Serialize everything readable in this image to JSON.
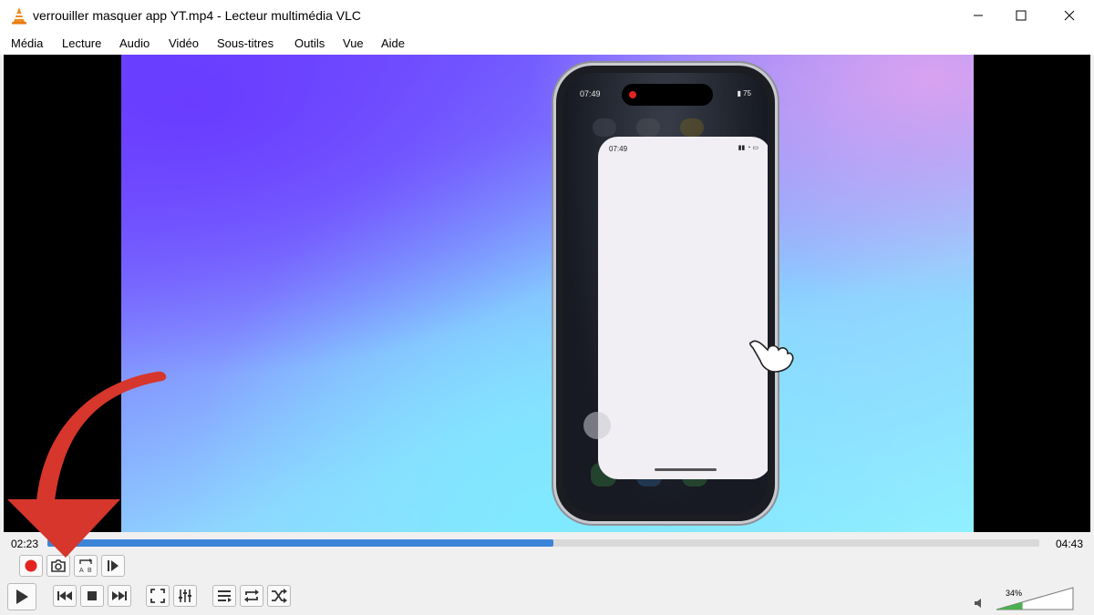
{
  "window": {
    "title": "verrouiller masquer app YT.mp4 - Lecteur multimédia VLC",
    "icon": "vlc-cone-icon"
  },
  "menu": {
    "items": [
      {
        "label": "Média"
      },
      {
        "label": "Lecture"
      },
      {
        "label": "Audio"
      },
      {
        "label": "Vidéo"
      },
      {
        "label": "Sous-titres"
      },
      {
        "label": "Outils"
      },
      {
        "label": "Vue"
      },
      {
        "label": "Aide"
      }
    ]
  },
  "video": {
    "phone_time": "07:49",
    "card_time": "07:49",
    "battery": "75"
  },
  "playback": {
    "elapsed": "02:23",
    "total": "04:43",
    "progress_fraction": 0.51
  },
  "volume": {
    "level_text": "34%",
    "level_fraction": 0.34
  },
  "colors": {
    "accent": "#3c84d8",
    "record": "#e3231f",
    "arrow": "#d6362c"
  }
}
